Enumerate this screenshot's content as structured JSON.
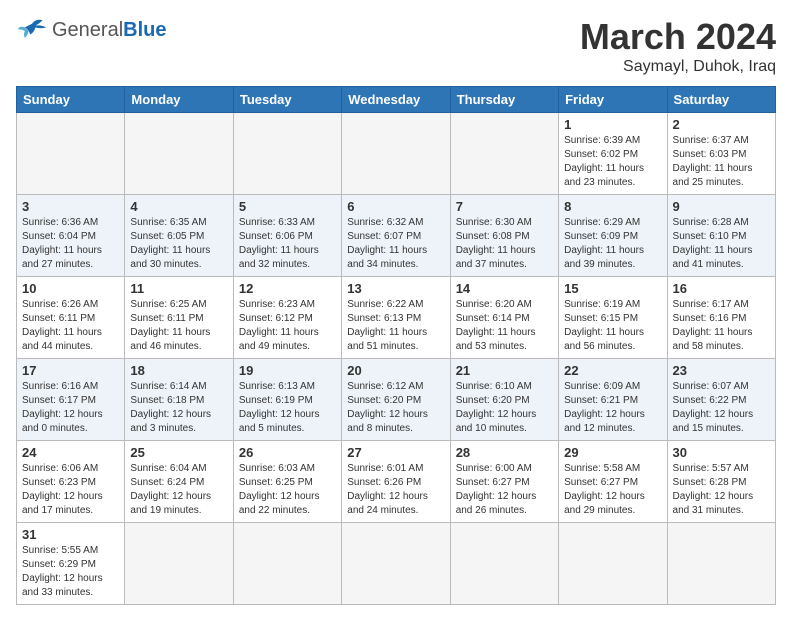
{
  "header": {
    "logo_general": "General",
    "logo_blue": "Blue",
    "month_title": "March 2024",
    "location": "Saymayl, Duhok, Iraq"
  },
  "weekdays": [
    "Sunday",
    "Monday",
    "Tuesday",
    "Wednesday",
    "Thursday",
    "Friday",
    "Saturday"
  ],
  "weeks": [
    [
      {
        "day": "",
        "info": ""
      },
      {
        "day": "",
        "info": ""
      },
      {
        "day": "",
        "info": ""
      },
      {
        "day": "",
        "info": ""
      },
      {
        "day": "",
        "info": ""
      },
      {
        "day": "1",
        "info": "Sunrise: 6:39 AM\nSunset: 6:02 PM\nDaylight: 11 hours\nand 23 minutes."
      },
      {
        "day": "2",
        "info": "Sunrise: 6:37 AM\nSunset: 6:03 PM\nDaylight: 11 hours\nand 25 minutes."
      }
    ],
    [
      {
        "day": "3",
        "info": "Sunrise: 6:36 AM\nSunset: 6:04 PM\nDaylight: 11 hours\nand 27 minutes."
      },
      {
        "day": "4",
        "info": "Sunrise: 6:35 AM\nSunset: 6:05 PM\nDaylight: 11 hours\nand 30 minutes."
      },
      {
        "day": "5",
        "info": "Sunrise: 6:33 AM\nSunset: 6:06 PM\nDaylight: 11 hours\nand 32 minutes."
      },
      {
        "day": "6",
        "info": "Sunrise: 6:32 AM\nSunset: 6:07 PM\nDaylight: 11 hours\nand 34 minutes."
      },
      {
        "day": "7",
        "info": "Sunrise: 6:30 AM\nSunset: 6:08 PM\nDaylight: 11 hours\nand 37 minutes."
      },
      {
        "day": "8",
        "info": "Sunrise: 6:29 AM\nSunset: 6:09 PM\nDaylight: 11 hours\nand 39 minutes."
      },
      {
        "day": "9",
        "info": "Sunrise: 6:28 AM\nSunset: 6:10 PM\nDaylight: 11 hours\nand 41 minutes."
      }
    ],
    [
      {
        "day": "10",
        "info": "Sunrise: 6:26 AM\nSunset: 6:11 PM\nDaylight: 11 hours\nand 44 minutes."
      },
      {
        "day": "11",
        "info": "Sunrise: 6:25 AM\nSunset: 6:11 PM\nDaylight: 11 hours\nand 46 minutes."
      },
      {
        "day": "12",
        "info": "Sunrise: 6:23 AM\nSunset: 6:12 PM\nDaylight: 11 hours\nand 49 minutes."
      },
      {
        "day": "13",
        "info": "Sunrise: 6:22 AM\nSunset: 6:13 PM\nDaylight: 11 hours\nand 51 minutes."
      },
      {
        "day": "14",
        "info": "Sunrise: 6:20 AM\nSunset: 6:14 PM\nDaylight: 11 hours\nand 53 minutes."
      },
      {
        "day": "15",
        "info": "Sunrise: 6:19 AM\nSunset: 6:15 PM\nDaylight: 11 hours\nand 56 minutes."
      },
      {
        "day": "16",
        "info": "Sunrise: 6:17 AM\nSunset: 6:16 PM\nDaylight: 11 hours\nand 58 minutes."
      }
    ],
    [
      {
        "day": "17",
        "info": "Sunrise: 6:16 AM\nSunset: 6:17 PM\nDaylight: 12 hours\nand 0 minutes."
      },
      {
        "day": "18",
        "info": "Sunrise: 6:14 AM\nSunset: 6:18 PM\nDaylight: 12 hours\nand 3 minutes."
      },
      {
        "day": "19",
        "info": "Sunrise: 6:13 AM\nSunset: 6:19 PM\nDaylight: 12 hours\nand 5 minutes."
      },
      {
        "day": "20",
        "info": "Sunrise: 6:12 AM\nSunset: 6:20 PM\nDaylight: 12 hours\nand 8 minutes."
      },
      {
        "day": "21",
        "info": "Sunrise: 6:10 AM\nSunset: 6:20 PM\nDaylight: 12 hours\nand 10 minutes."
      },
      {
        "day": "22",
        "info": "Sunrise: 6:09 AM\nSunset: 6:21 PM\nDaylight: 12 hours\nand 12 minutes."
      },
      {
        "day": "23",
        "info": "Sunrise: 6:07 AM\nSunset: 6:22 PM\nDaylight: 12 hours\nand 15 minutes."
      }
    ],
    [
      {
        "day": "24",
        "info": "Sunrise: 6:06 AM\nSunset: 6:23 PM\nDaylight: 12 hours\nand 17 minutes."
      },
      {
        "day": "25",
        "info": "Sunrise: 6:04 AM\nSunset: 6:24 PM\nDaylight: 12 hours\nand 19 minutes."
      },
      {
        "day": "26",
        "info": "Sunrise: 6:03 AM\nSunset: 6:25 PM\nDaylight: 12 hours\nand 22 minutes."
      },
      {
        "day": "27",
        "info": "Sunrise: 6:01 AM\nSunset: 6:26 PM\nDaylight: 12 hours\nand 24 minutes."
      },
      {
        "day": "28",
        "info": "Sunrise: 6:00 AM\nSunset: 6:27 PM\nDaylight: 12 hours\nand 26 minutes."
      },
      {
        "day": "29",
        "info": "Sunrise: 5:58 AM\nSunset: 6:27 PM\nDaylight: 12 hours\nand 29 minutes."
      },
      {
        "day": "30",
        "info": "Sunrise: 5:57 AM\nSunset: 6:28 PM\nDaylight: 12 hours\nand 31 minutes."
      }
    ],
    [
      {
        "day": "31",
        "info": "Sunrise: 5:55 AM\nSunset: 6:29 PM\nDaylight: 12 hours\nand 33 minutes."
      },
      {
        "day": "",
        "info": ""
      },
      {
        "day": "",
        "info": ""
      },
      {
        "day": "",
        "info": ""
      },
      {
        "day": "",
        "info": ""
      },
      {
        "day": "",
        "info": ""
      },
      {
        "day": "",
        "info": ""
      }
    ]
  ]
}
